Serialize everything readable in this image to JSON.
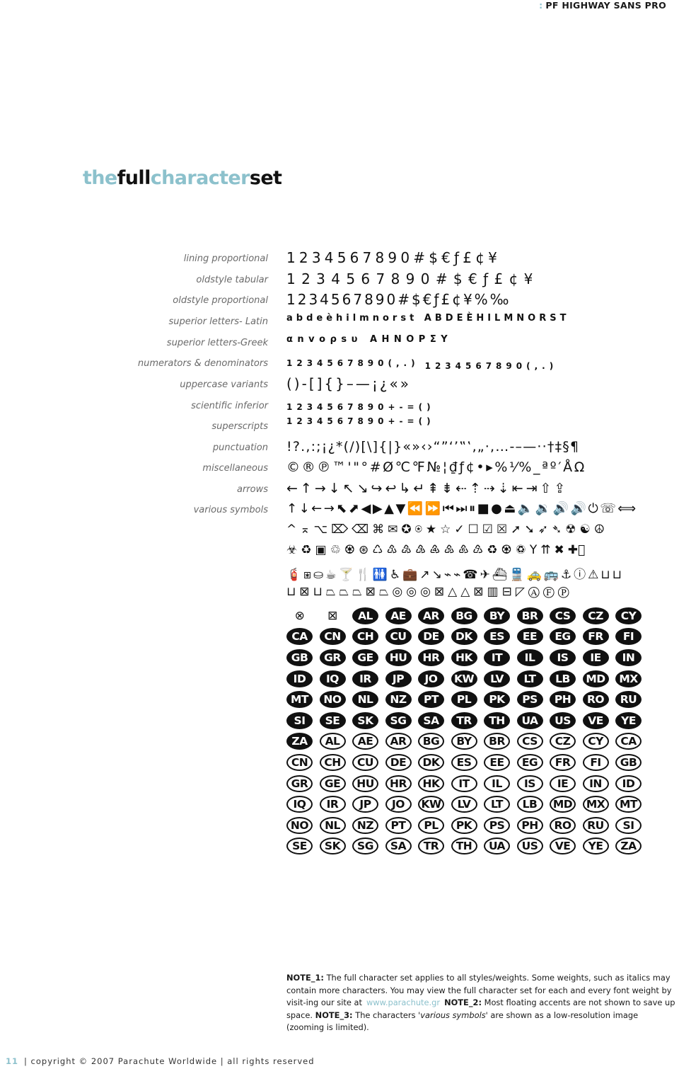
{
  "header": {
    "brand": "PF HIGHWAY SANS PRO",
    "brand_separator": ":"
  },
  "title": {
    "part1": "the",
    "part2": "full",
    "part3": "character",
    "part4": "set"
  },
  "colors": {
    "accent": "#8cc1cc",
    "text": "#111111",
    "label": "#6a6a6a"
  },
  "rows": [
    {
      "label": "lining proportional",
      "glyphs": "1234567890#$€ƒ£¢¥"
    },
    {
      "label": "oldstyle tabular",
      "glyphs": "1 2 3 4 5 6 7 8 9 0 # $ € ƒ £ ¢ ¥"
    },
    {
      "label": "oldstyle proportional",
      "glyphs": "1234567890#$€ƒ£¢¥%‰"
    },
    {
      "label": "superior letters- Latin",
      "glyphs": "abdeèhilmnorst ABDEÈHILMNORST"
    },
    {
      "label": "superior letters-Greek",
      "glyphs": "αnvoρsυ ΑΗΝΟΡΣΥ"
    },
    {
      "label": "numerators & denominators",
      "glyphs": "1234567890(,.)",
      "glyphs2": "1234567890(,.)"
    },
    {
      "label": "uppercase variants",
      "glyphs": "()-[]{}–—¡¿«»"
    },
    {
      "label": "scientific inferior",
      "glyphs": "1234567890+-=()"
    },
    {
      "label": "superscripts",
      "glyphs": "1234567890+-=()"
    },
    {
      "label": "punctuation",
      "glyphs": "!?.,:;¡¿*(/)[\\]{|}«»‹›“”‘’‟‛‚„·,…-–—··†‡§¶"
    },
    {
      "label": "miscellaneous",
      "glyphs": "©®℗™'\"°#Ø℃℉№¦₫ƒ¢•▸%⅟%_ªº′ÅΩ"
    },
    {
      "label": "arrows",
      "glyphs": "←↑→↓↖↘↪↩↳↵⇞⇟⇠⇡⇢⇣⇤⇥⇧⇪"
    },
    {
      "label": "various symbols",
      "glyphs": "↑↓←→⬉⬈◀▶▲▼⏪⏩⏮⏭⏸■●⏏🔈🔉🔊🔊⏻☏⟺"
    }
  ],
  "symbols": {
    "row2": "^⌅⌥⌦⌫⌘✉✪⍟★☆✓☐☑☒➚➘➶➴☢☯☮",
    "row3": "☣♻▣♲♼⊛♺♳♴♵♶♷♸♹♻♼♽Y⇈✖✚⃠",
    "row4": "🧯⧆⛀☕🍸🍴🚻♿💼↗↘⌁⌁☎✈⛴🚆🚕🚌⚓ⓘ⚠⊔⊔",
    "row5": "⊔⊠⊔⏢⏢⏢⊠⏢◎◎◎⊠△△⊠▥⊟◸ⒶⒻⓅ",
    "row6_icons": [
      "⊗",
      "⊠"
    ]
  },
  "badges": {
    "filled": [
      "AL",
      "AE",
      "AR",
      "BG",
      "BY",
      "BR",
      "CS",
      "CZ",
      "CY",
      "CA",
      "CN",
      "CH",
      "CU",
      "DE",
      "DK",
      "ES",
      "EE",
      "EG",
      "FR",
      "FI",
      "GB",
      "GR",
      "GE",
      "HU",
      "HR",
      "HK",
      "IT",
      "IL",
      "IS",
      "IE",
      "IN",
      "ID",
      "IQ",
      "IR",
      "JP",
      "JO",
      "KW",
      "LV",
      "LT",
      "LB",
      "MD",
      "MX",
      "MT",
      "NO",
      "NL",
      "NZ",
      "PT",
      "PL",
      "PK",
      "PS",
      "PH",
      "RO",
      "RU",
      "SI",
      "SE",
      "SK",
      "SG",
      "SA",
      "TR",
      "TH",
      "UA",
      "US",
      "VE",
      "YE",
      "ZA"
    ],
    "outline": [
      "AL",
      "AE",
      "AR",
      "BG",
      "BY",
      "BR",
      "CS",
      "CZ",
      "CY",
      "CA",
      "CN",
      "CH",
      "CU",
      "DE",
      "DK",
      "ES",
      "EE",
      "EG",
      "FR",
      "FI",
      "GB",
      "GR",
      "GE",
      "HU",
      "HR",
      "HK",
      "IT",
      "IL",
      "IS",
      "IE",
      "IN",
      "ID",
      "IQ",
      "IR",
      "JP",
      "JO",
      "KW",
      "LV",
      "LT",
      "LB",
      "MD",
      "MX",
      "MT",
      "NO",
      "NL",
      "NZ",
      "PT",
      "PL",
      "PK",
      "PS",
      "PH",
      "RO",
      "RU",
      "SI",
      "SE",
      "SK",
      "SG",
      "SA",
      "TR",
      "TH",
      "UA",
      "US",
      "VE",
      "YE",
      "ZA"
    ]
  },
  "notes": {
    "note1_label": "NOTE_1:",
    "note1_text": " The full character set applies to all styles/weights. Some weights, such as italics may contain more characters. You may view the full character set for each and every font weight by visit-ing our site at",
    "link": "www.parachute.gr",
    "note2_label": "NOTE_2:",
    "note2_text": " Most floating accents are not shown to save up space.",
    "note3_label": "NOTE_3:",
    "note3_pre": " The characters ",
    "note3_em": "'various symbols'",
    "note3_post": " are shown as a low-resolution image (zooming is limited)."
  },
  "footer": {
    "page": "11",
    "text": "| copyright © 2007 Parachute Worldwide | all rights reserved"
  }
}
